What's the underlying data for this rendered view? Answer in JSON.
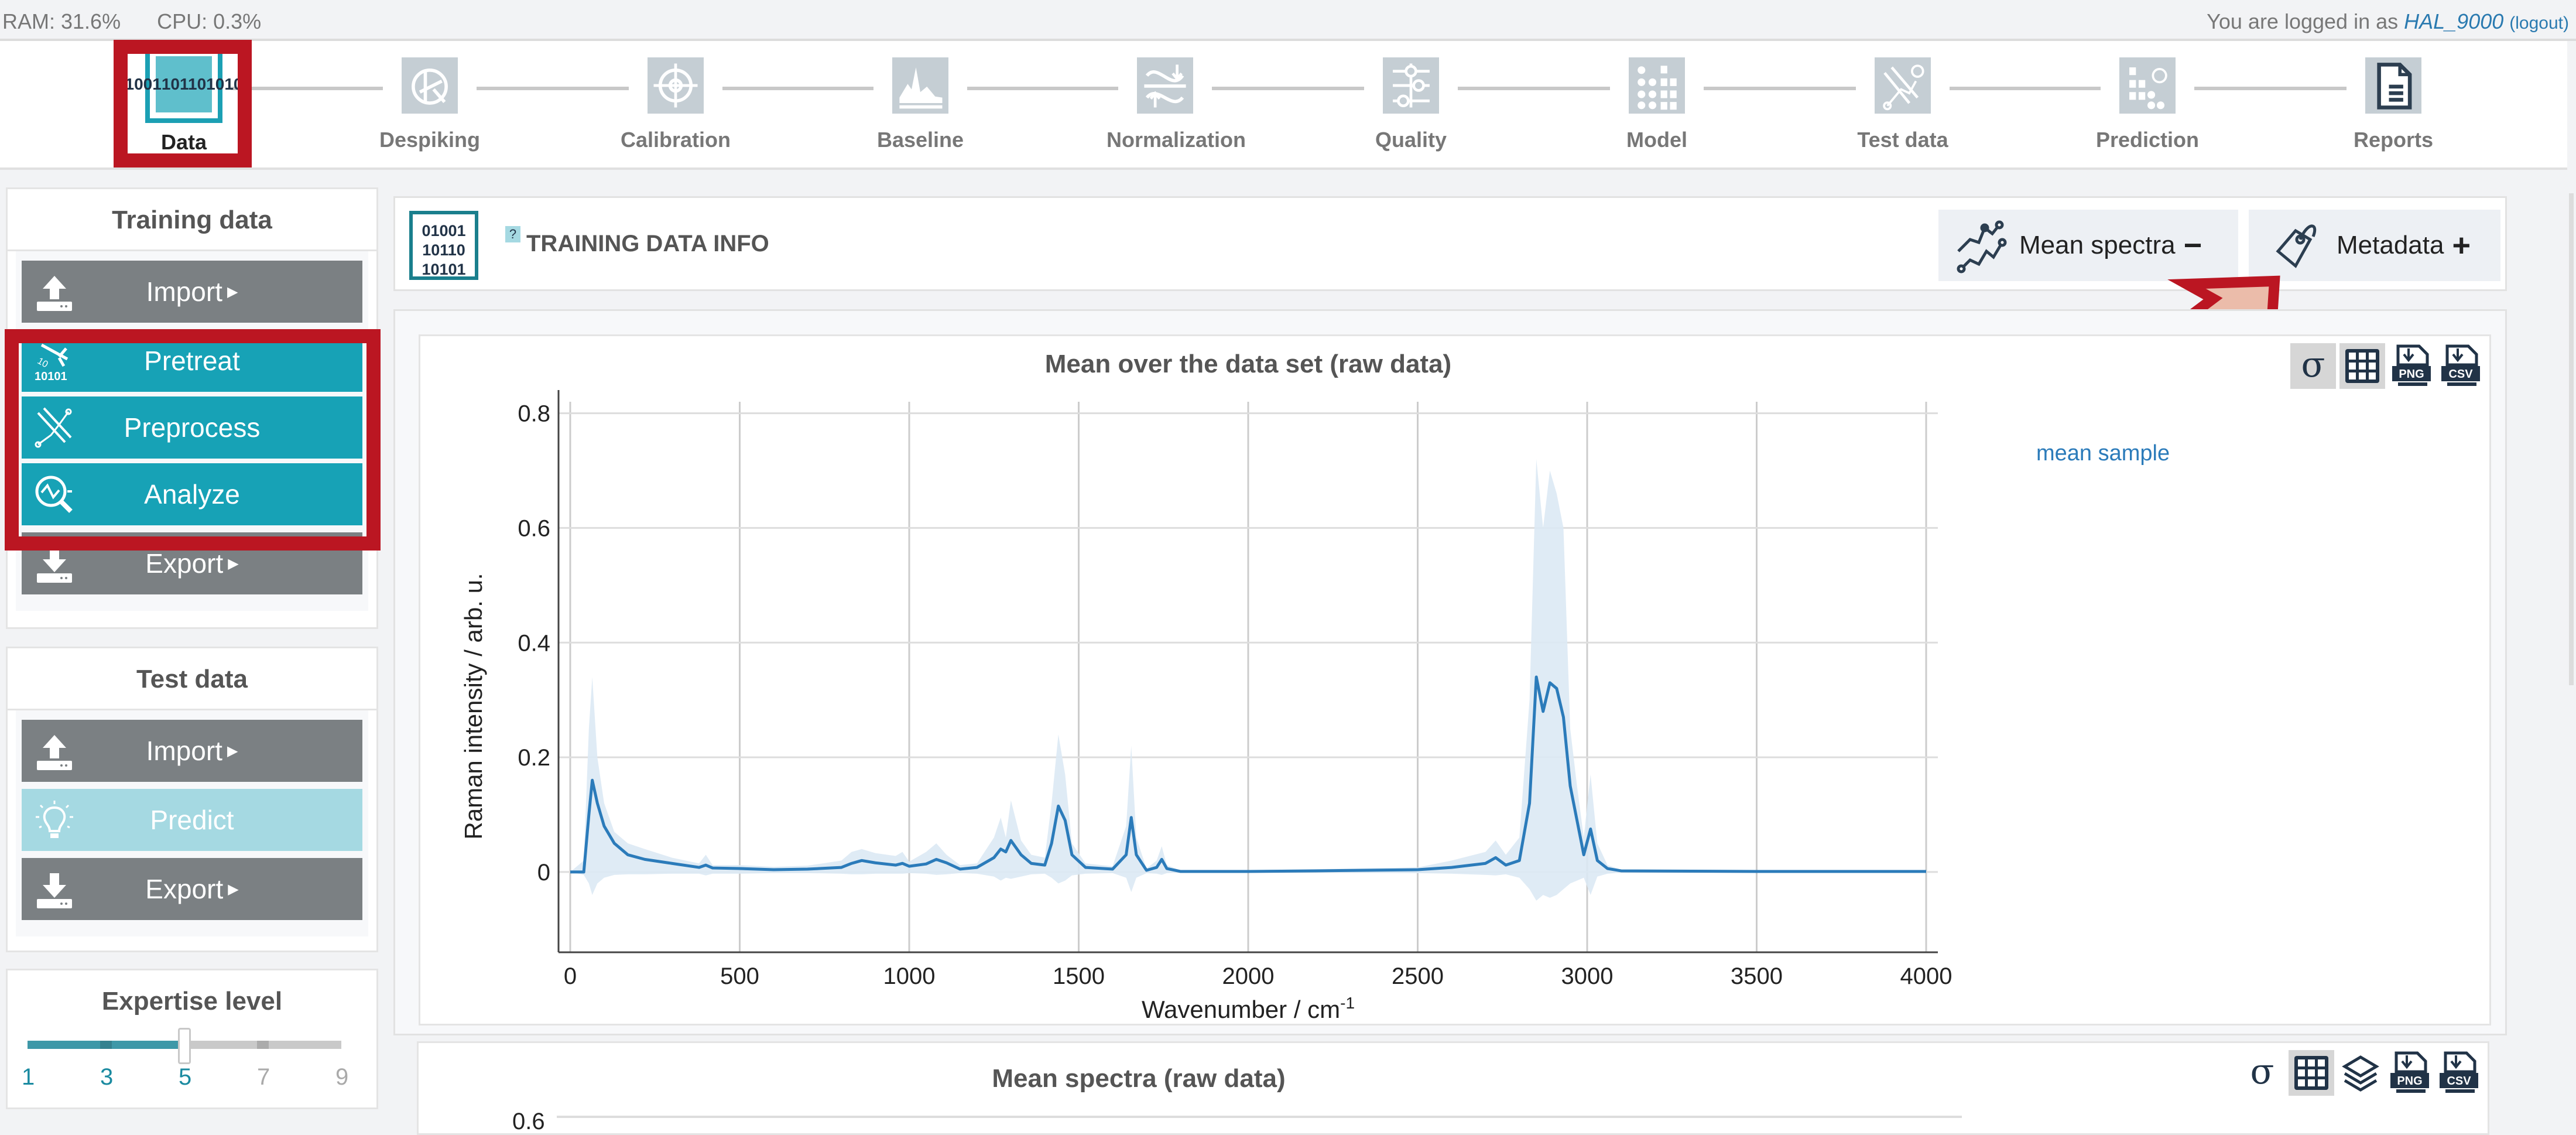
{
  "system": {
    "ram": "RAM: 31.6%",
    "cpu": "CPU: 0.3%"
  },
  "login": {
    "prefix": "You are logged in as",
    "user": "HAL_9000",
    "logout": "(logout)"
  },
  "workflow": [
    {
      "label": "Data",
      "icon": "binary-data-icon",
      "active": true
    },
    {
      "label": "Despiking",
      "icon": "despiking-icon"
    },
    {
      "label": "Calibration",
      "icon": "crosshair-target-icon"
    },
    {
      "label": "Baseline",
      "icon": "baseline-spectrum-icon"
    },
    {
      "label": "Normalization",
      "icon": "normalization-icon"
    },
    {
      "label": "Quality",
      "icon": "sliders-icon"
    },
    {
      "label": "Model",
      "icon": "model-grid-icon"
    },
    {
      "label": "Test data",
      "icon": "test-data-icon"
    },
    {
      "label": "Prediction",
      "icon": "prediction-icon"
    },
    {
      "label": "Reports",
      "icon": "report-document-icon"
    }
  ],
  "data_icon_text": [
    "01001",
    "10110",
    "10101"
  ],
  "sidebar": {
    "training": {
      "title": "Training data",
      "buttons": [
        {
          "label": "Import",
          "style": "gray",
          "caret": true,
          "icon": "upload-icon"
        },
        {
          "label": "Pretreat",
          "style": "teal",
          "caret": false,
          "icon": "pretreat-icon"
        },
        {
          "label": "Preprocess",
          "style": "teal",
          "caret": false,
          "icon": "preprocess-icon"
        },
        {
          "label": "Analyze",
          "style": "teal",
          "caret": false,
          "icon": "analyze-icon"
        },
        {
          "label": "Export",
          "style": "gray",
          "caret": true,
          "icon": "download-icon"
        }
      ]
    },
    "test": {
      "title": "Test data",
      "buttons": [
        {
          "label": "Import",
          "style": "gray",
          "caret": true,
          "icon": "upload-icon"
        },
        {
          "label": "Predict",
          "style": "light",
          "caret": false,
          "icon": "lightbulb-icon"
        },
        {
          "label": "Export",
          "style": "gray",
          "caret": true,
          "icon": "download-icon"
        }
      ]
    },
    "expertise": {
      "title": "Expertise level",
      "levels": [
        "1",
        "3",
        "5",
        "7",
        "9"
      ],
      "value": 5,
      "min": 1,
      "max": 9
    }
  },
  "info": {
    "title": "TRAINING DATA INFO",
    "help": "?",
    "mean_spectra_label": "Mean spectra",
    "mean_spectra_state": "−",
    "metadata_label": "Metadata",
    "metadata_state": "+"
  },
  "chart_tools_1": [
    {
      "name": "sigma-icon",
      "label": "σ",
      "active": true
    },
    {
      "name": "grid-icon",
      "active": true
    },
    {
      "name": "png-download-icon",
      "label": "PNG"
    },
    {
      "name": "csv-download-icon",
      "label": "CSV"
    }
  ],
  "chart_tools_2": [
    {
      "name": "sigma-icon",
      "label": "σ"
    },
    {
      "name": "grid-icon",
      "active": true
    },
    {
      "name": "layers-icon"
    },
    {
      "name": "png-download-icon",
      "label": "PNG"
    },
    {
      "name": "csv-download-icon",
      "label": "CSV"
    }
  ],
  "chart2": {
    "title": "Mean spectra (raw data)",
    "first_tick": "0.6"
  },
  "colors": {
    "accent": "#17a2b6",
    "line": "#2b7bba",
    "band": "#dce9f4",
    "highlight": "#bb1622",
    "arrow_fill": "#ebbcaa"
  },
  "chart_data": {
    "type": "line",
    "title": "Mean over the data set (raw data)",
    "xlabel": "Wavenumber / cm",
    "xlabel_sup": "-1",
    "ylabel": "Raman intensity / arb. u.",
    "xlim": [
      0,
      4000
    ],
    "ylim": [
      -0.14,
      0.82
    ],
    "xticks": [
      0,
      500,
      1000,
      1500,
      2000,
      2500,
      3000,
      3500,
      4000
    ],
    "yticks": [
      0,
      0.2,
      0.4,
      0.6,
      0.8
    ],
    "ytick_labels": [
      "0",
      "0.2",
      "0.4",
      "0.6",
      "0.8"
    ],
    "grid": true,
    "legend": {
      "position": "right",
      "entries": [
        "mean sample"
      ]
    },
    "series": [
      {
        "name": "mean sample",
        "x": [
          0,
          40,
          55,
          65,
          80,
          100,
          130,
          170,
          220,
          300,
          380,
          400,
          420,
          500,
          600,
          700,
          800,
          830,
          860,
          900,
          960,
          980,
          1000,
          1050,
          1080,
          1110,
          1150,
          1200,
          1250,
          1270,
          1285,
          1300,
          1330,
          1360,
          1400,
          1420,
          1440,
          1460,
          1480,
          1520,
          1600,
          1640,
          1655,
          1670,
          1700,
          1730,
          1745,
          1760,
          1800,
          2000,
          2200,
          2500,
          2600,
          2700,
          2730,
          2760,
          2800,
          2830,
          2850,
          2870,
          2890,
          2910,
          2930,
          2950,
          2970,
          2990,
          3010,
          3030,
          3060,
          3100,
          3500,
          4000
        ],
        "y": [
          0,
          0,
          0.1,
          0.16,
          0.12,
          0.08,
          0.05,
          0.03,
          0.022,
          0.015,
          0.008,
          0.012,
          0.007,
          0.006,
          0.004,
          0.005,
          0.008,
          0.015,
          0.02,
          0.016,
          0.012,
          0.015,
          0.01,
          0.014,
          0.022,
          0.016,
          0.005,
          0.008,
          0.025,
          0.04,
          0.035,
          0.055,
          0.03,
          0.015,
          0.012,
          0.05,
          0.115,
          0.09,
          0.03,
          0.008,
          0.005,
          0.03,
          0.095,
          0.03,
          0.003,
          0.008,
          0.022,
          0.006,
          0.001,
          0.001,
          0.002,
          0.004,
          0.008,
          0.015,
          0.025,
          0.012,
          0.02,
          0.12,
          0.34,
          0.28,
          0.33,
          0.32,
          0.27,
          0.15,
          0.09,
          0.03,
          0.075,
          0.02,
          0.006,
          0.002,
          0.001,
          0.001
        ]
      }
    ],
    "band_upper": [
      0,
      0.02,
      0.25,
      0.34,
      0.2,
      0.12,
      0.07,
      0.05,
      0.04,
      0.025,
      0.015,
      0.03,
      0.012,
      0.012,
      0.009,
      0.011,
      0.02,
      0.035,
      0.04,
      0.033,
      0.028,
      0.035,
      0.018,
      0.035,
      0.05,
      0.03,
      0.012,
      0.015,
      0.06,
      0.095,
      0.06,
      0.125,
      0.055,
      0.03,
      0.025,
      0.12,
      0.24,
      0.17,
      0.05,
      0.015,
      0.01,
      0.08,
      0.22,
      0.06,
      0.006,
      0.02,
      0.045,
      0.012,
      0.003,
      0.003,
      0.005,
      0.008,
      0.02,
      0.035,
      0.055,
      0.03,
      0.06,
      0.3,
      0.72,
      0.6,
      0.7,
      0.66,
      0.6,
      0.25,
      0.15,
      0.06,
      0.17,
      0.05,
      0.012,
      0.004,
      0.002,
      0.002
    ],
    "band_lower": [
      0,
      -0.005,
      -0.02,
      -0.04,
      -0.02,
      -0.01,
      -0.005,
      -0.004,
      -0.004,
      -0.003,
      -0.003,
      -0.006,
      -0.003,
      -0.003,
      -0.002,
      -0.002,
      -0.003,
      -0.004,
      -0.004,
      -0.003,
      -0.003,
      -0.003,
      -0.002,
      -0.003,
      -0.005,
      -0.004,
      -0.002,
      -0.003,
      -0.008,
      -0.015,
      -0.01,
      -0.012,
      -0.008,
      -0.004,
      -0.003,
      -0.01,
      -0.02,
      -0.015,
      -0.006,
      -0.003,
      -0.002,
      -0.01,
      -0.035,
      -0.01,
      -0.002,
      -0.003,
      -0.005,
      -0.002,
      -0.001,
      -0.001,
      -0.001,
      -0.002,
      -0.003,
      -0.005,
      -0.006,
      -0.004,
      -0.01,
      -0.03,
      -0.05,
      -0.04,
      -0.045,
      -0.04,
      -0.03,
      -0.02,
      -0.015,
      -0.01,
      -0.04,
      -0.008,
      -0.003,
      -0.001,
      -0.001,
      -0.001
    ]
  }
}
